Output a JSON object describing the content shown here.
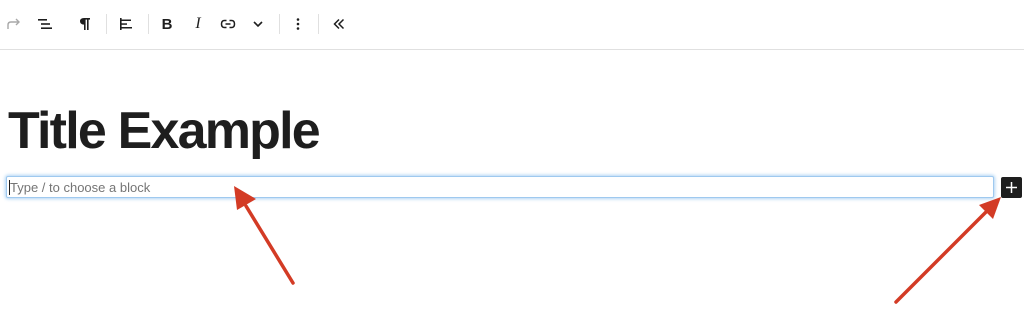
{
  "toolbar": {
    "buttons": [
      {
        "icon": "redo-icon"
      },
      {
        "icon": "document-overview-icon"
      },
      {
        "icon": "paragraph-icon"
      },
      {
        "icon": "align-left-icon"
      },
      {
        "icon": "bold-icon",
        "label": "B"
      },
      {
        "icon": "italic-icon",
        "label": "I"
      },
      {
        "icon": "link-icon"
      },
      {
        "icon": "chevron-down-icon"
      },
      {
        "icon": "more-options-icon"
      },
      {
        "icon": "collapse-toolbar-icon"
      }
    ]
  },
  "editor": {
    "title": "Title Example",
    "block_placeholder": "Type / to choose a block",
    "add_block_icon": "plus-icon"
  },
  "annotations": {
    "arrow_color": "#d33b25",
    "focus_color": "#9fc9ef"
  }
}
